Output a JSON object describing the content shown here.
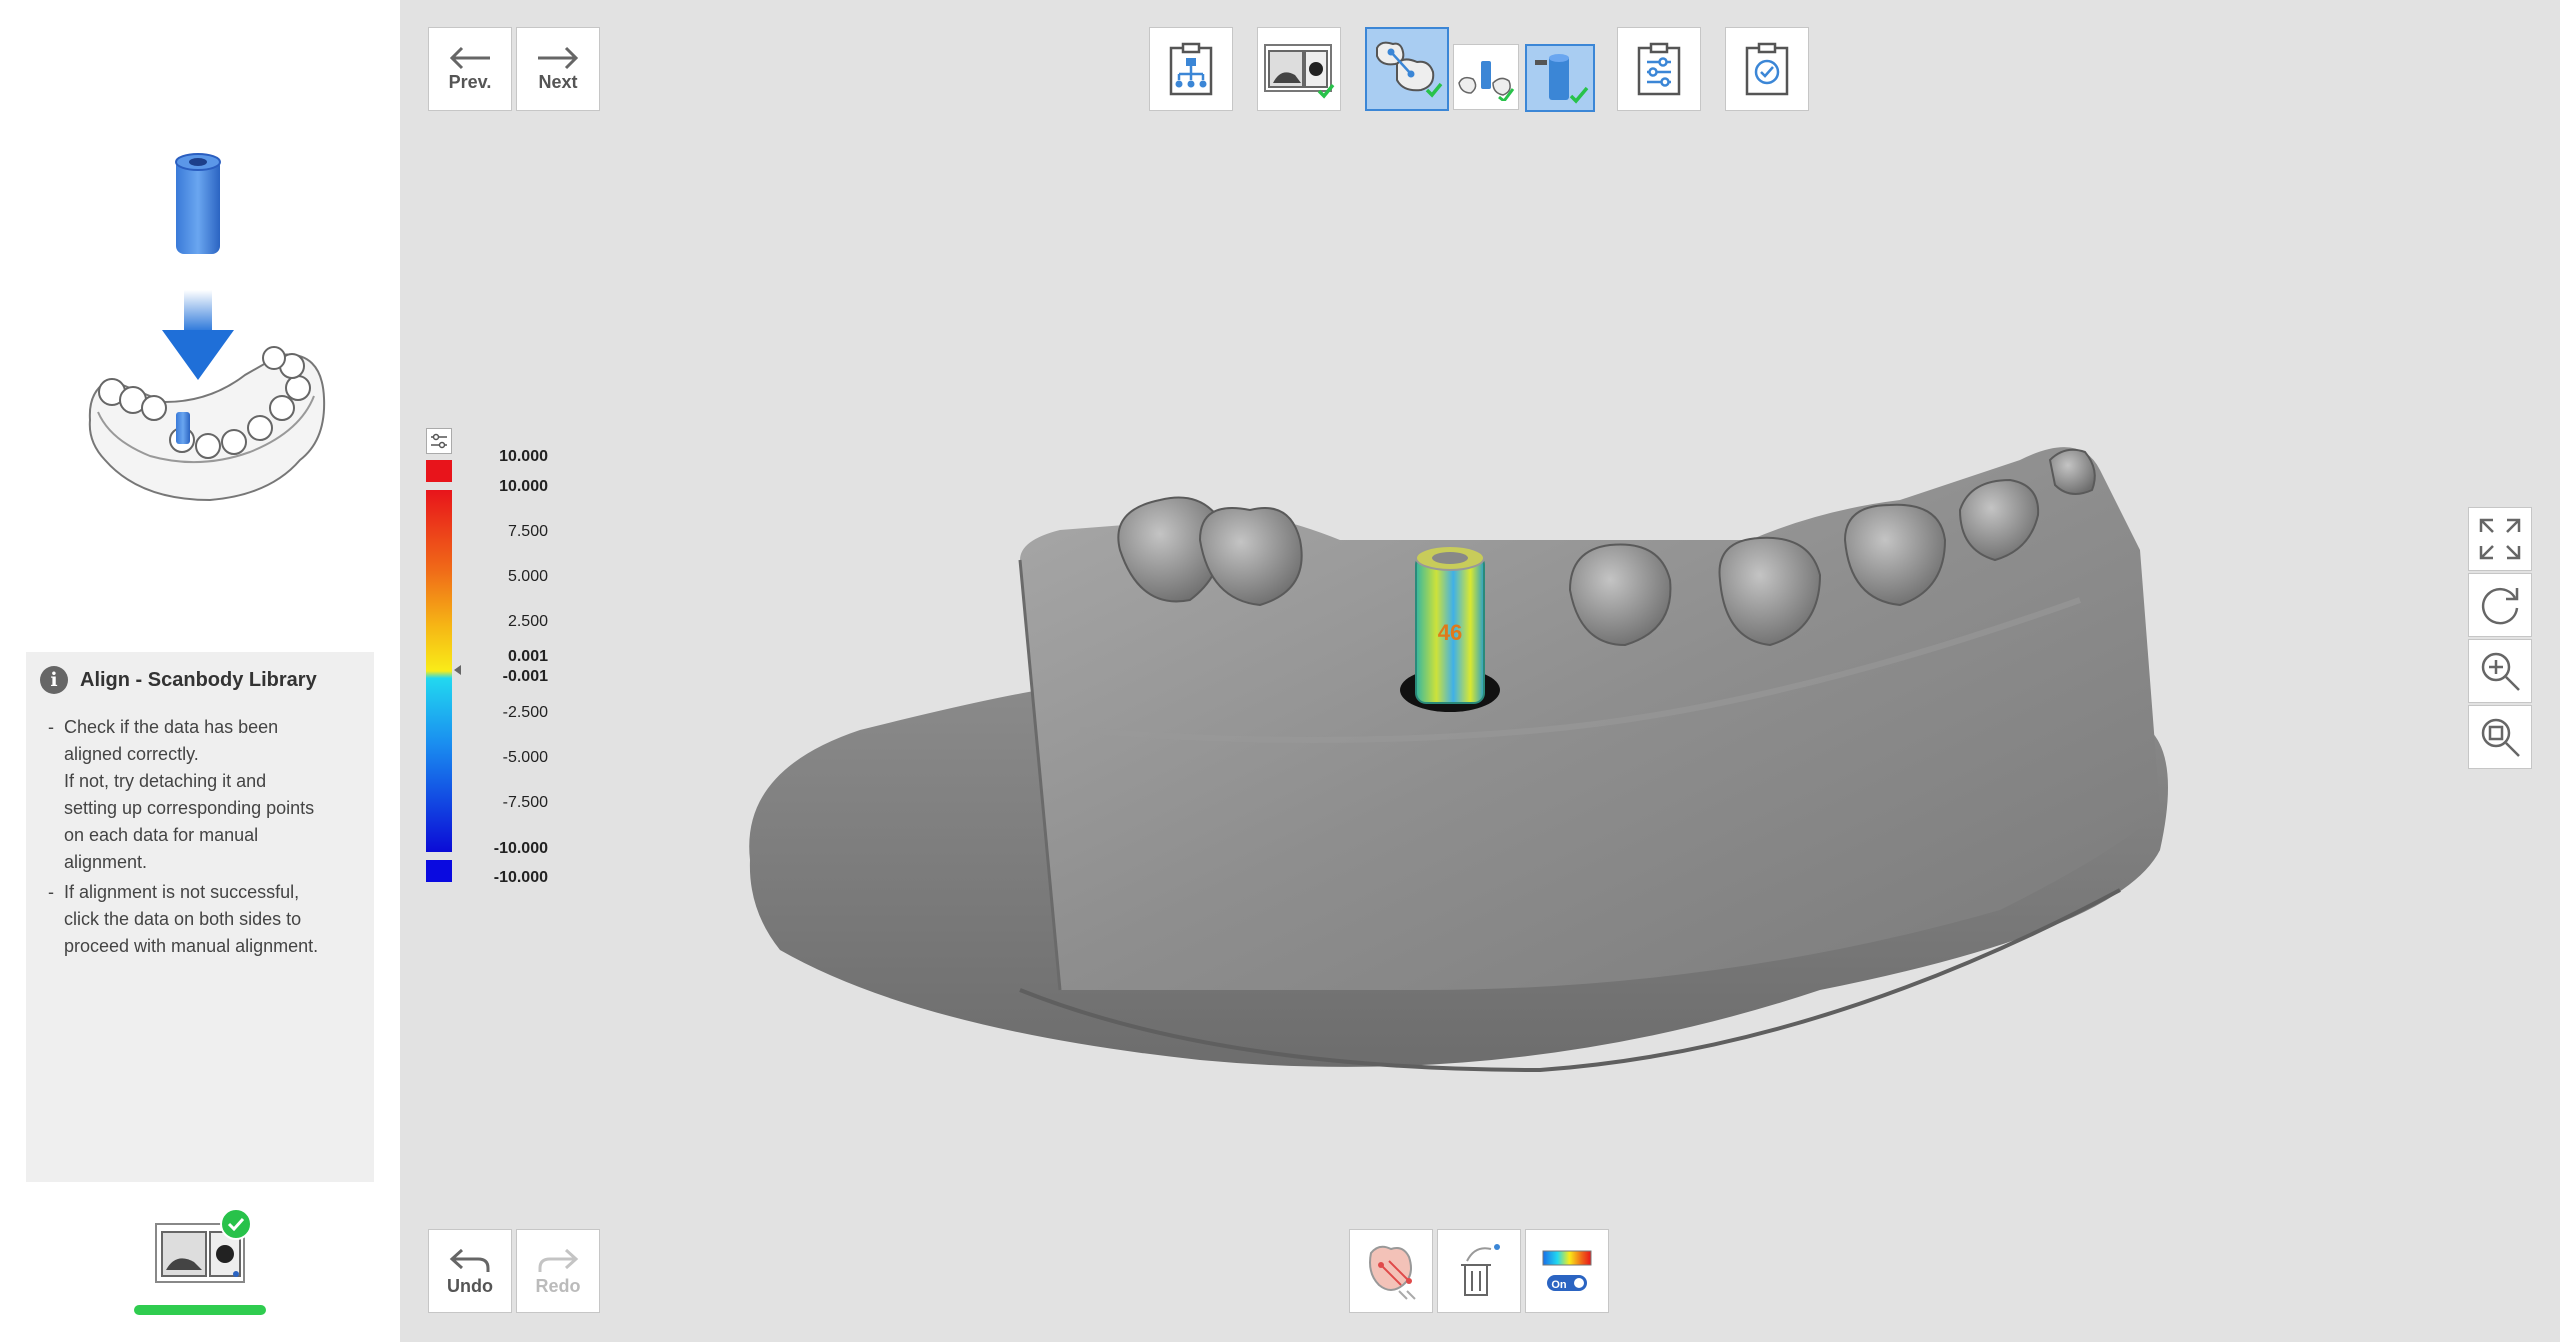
{
  "nav": {
    "prev_label": "Prev.",
    "next_label": "Next"
  },
  "history": {
    "undo_label": "Undo",
    "redo_label": "Redo"
  },
  "info": {
    "title": "Align - Scanbody Library",
    "items": [
      {
        "line1": "Check if the data has been",
        "line2": "aligned correctly.",
        "line3": "If not, try detaching it and",
        "line4": "setting up corresponding points",
        "line5": "on each data for manual",
        "line6": "alignment."
      },
      {
        "line1": "If alignment is not successful,",
        "line2": "click the data on both sides to",
        "line3": "proceed with manual alignment."
      }
    ]
  },
  "legend": {
    "values": [
      "10.000",
      "10.000",
      "7.500",
      "5.000",
      "2.500",
      "0.001",
      "-0.001",
      "-2.500",
      "-5.000",
      "-7.500",
      "-10.000",
      "-10.000"
    ],
    "colors": {
      "max": "#e8141b",
      "min": "#0a0ae0"
    }
  },
  "toolbar": {
    "icons": [
      "workflow-icon",
      "scan-data-icon",
      "align-teeth-icon",
      "align-scanbody-icon",
      "scanbody-library-icon",
      "settings-icon",
      "complete-icon"
    ]
  },
  "bottom_tools": {
    "icons": [
      "tooth-color-icon",
      "delete-data-icon",
      "deviation-map-icon"
    ],
    "toggle_label": "On"
  },
  "model_label": "46",
  "colors": {
    "accent": "#3b86d6",
    "active_bg": "#a9cdf2",
    "success": "#28c24a",
    "background": "#e2e2e2"
  }
}
